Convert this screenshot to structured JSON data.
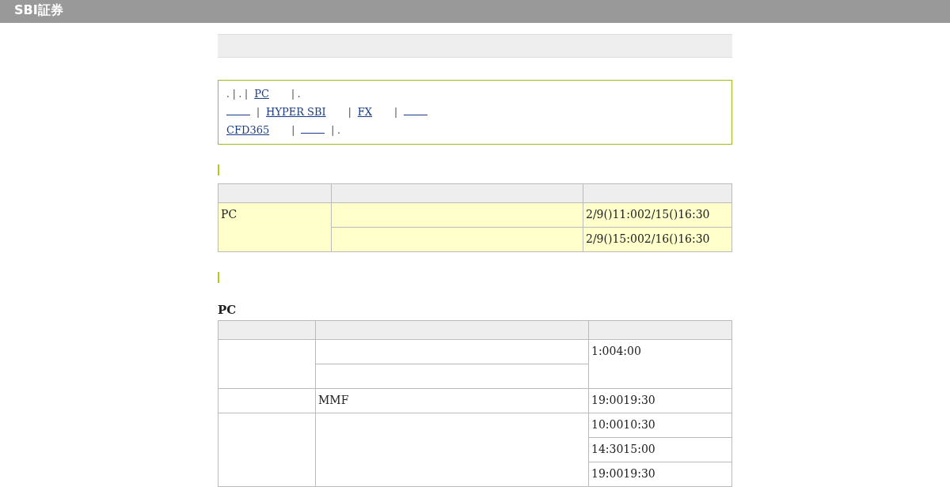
{
  "header": {
    "logo": "SBI証券"
  },
  "notice": {
    "lines": [
      [
        {
          "kind": "text",
          "text": ". | . |"
        },
        {
          "kind": "link",
          "text": "PC"
        },
        {
          "kind": "text",
          "text": "| ."
        }
      ],
      [
        {
          "kind": "link"
        },
        {
          "kind": "text",
          "text": "|"
        },
        {
          "kind": "link",
          "text": "HYPER SBI"
        },
        {
          "kind": "text",
          "text": "|"
        },
        {
          "kind": "link",
          "text": "FX"
        },
        {
          "kind": "text",
          "text": "|"
        },
        {
          "kind": "link"
        }
      ],
      [
        {
          "kind": "link",
          "text": "CFD365"
        },
        {
          "kind": "text",
          "text": "|"
        },
        {
          "kind": "link"
        },
        {
          "kind": "text",
          "text": "| ."
        }
      ]
    ]
  },
  "sections": [
    {
      "tables": [
        {
          "groups": [
            {
              "columns": [
                [
                  {
                    "text": "PC"
                  }
                ],
                [
                  {},
                  {}
                ],
                [
                  {
                    "text": "2/9()11:002/15()16:30"
                  },
                  {
                    "text": "2/9()15:002/16()16:30"
                  }
                ]
              ]
            }
          ]
        }
      ]
    },
    {
      "tables": [
        {
          "caption": "PC",
          "groups": [
            {
              "columns": [
                [
                  {}
                ],
                [
                  {},
                  {}
                ],
                [
                  {
                    "text": "1:004:00"
                  }
                ]
              ]
            },
            {
              "columns": [
                [
                  {}
                ],
                [
                  {
                    "text": "MMF"
                  }
                ],
                [
                  {
                    "text": "19:0019:30"
                  }
                ]
              ]
            },
            {
              "columns": [
                [
                  {}
                ],
                [
                  {}
                ],
                [
                  {
                    "text": "10:0010:30"
                  },
                  {
                    "text": "14:3015:00"
                  },
                  {
                    "text": "19:0019:30"
                  }
                ]
              ]
            }
          ]
        }
      ]
    }
  ]
}
